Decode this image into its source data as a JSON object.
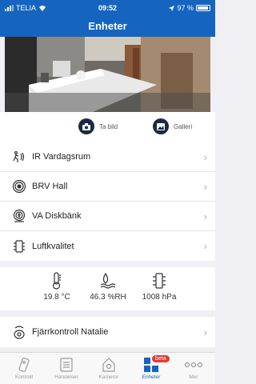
{
  "status": {
    "carrier": "TELIA",
    "time": "09:52",
    "battery": "97 %"
  },
  "nav": {
    "title": "Enheter"
  },
  "camera_actions": {
    "photo": "Ta bild",
    "gallery": "Galleri"
  },
  "devices": [
    {
      "label": "IR Vardagsrum",
      "icon": "motion-sensor-icon"
    },
    {
      "label": "BRV Hall",
      "icon": "smoke-detector-icon"
    },
    {
      "label": "VA Diskbänk",
      "icon": "water-alarm-icon"
    },
    {
      "label": "Luftkvalitet",
      "icon": "air-quality-icon"
    }
  ],
  "air": {
    "temperature": "19.8 °C",
    "humidity": "46.3 %RH",
    "pressure": "1008 hPa"
  },
  "remote": {
    "label": "Fjärrkontroll Natalie"
  },
  "tabs": [
    {
      "label": "Kontroll"
    },
    {
      "label": "Händelser"
    },
    {
      "label": "Kameror"
    },
    {
      "label": "Enheter",
      "badge": "beta"
    },
    {
      "label": "Mer"
    }
  ],
  "colors": {
    "accent": "#1565c0",
    "badge": "#e53935"
  }
}
